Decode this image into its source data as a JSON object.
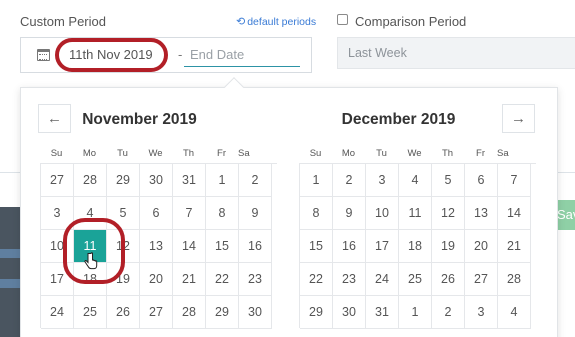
{
  "custom_period": {
    "label": "Custom Period",
    "default_link": "default periods",
    "start_date": "11th Nov 2019",
    "separator": "-",
    "end_placeholder": "End Date"
  },
  "comparison": {
    "label": "Comparison Period",
    "checked": false,
    "selected": "Last Week"
  },
  "background": {
    "save_partial": "Sav"
  },
  "calendar": {
    "prev_icon": "arrow-left-icon",
    "next_icon": "arrow-right-icon",
    "weekdays": [
      "Su",
      "Mo",
      "Tu",
      "We",
      "Th",
      "Fr",
      "Sa"
    ],
    "months": [
      {
        "title": "November 2019",
        "days": [
          "27",
          "28",
          "29",
          "30",
          "31",
          "1",
          "2",
          "3",
          "4",
          "5",
          "6",
          "7",
          "8",
          "9",
          "10",
          "11",
          "12",
          "13",
          "14",
          "15",
          "16",
          "17",
          "18",
          "19",
          "20",
          "21",
          "22",
          "23",
          "24",
          "25",
          "26",
          "27",
          "28",
          "29",
          "30"
        ],
        "selected_day": "11"
      },
      {
        "title": "December 2019",
        "days": [
          "1",
          "2",
          "3",
          "4",
          "5",
          "6",
          "7",
          "8",
          "9",
          "10",
          "11",
          "12",
          "13",
          "14",
          "15",
          "16",
          "17",
          "18",
          "19",
          "20",
          "21",
          "22",
          "23",
          "24",
          "25",
          "26",
          "27",
          "28",
          "29",
          "30",
          "31",
          "1",
          "2",
          "3",
          "4"
        ]
      }
    ]
  },
  "colors": {
    "selected_day": "#1aa398",
    "highlight_oval": "#b21f27",
    "link": "#3a7bd5",
    "input_underline": "#2d93a6"
  }
}
